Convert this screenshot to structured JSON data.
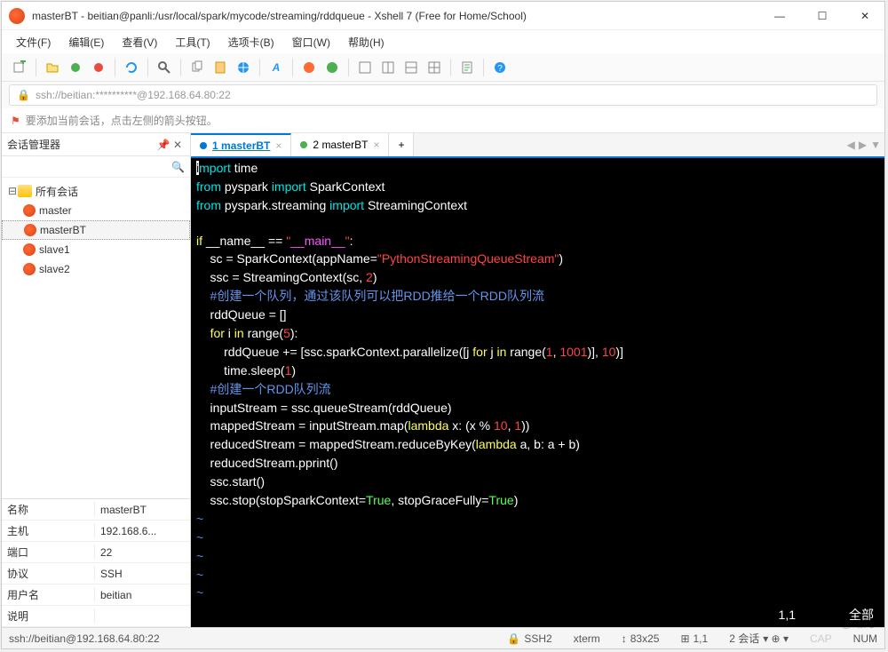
{
  "window": {
    "title": "masterBT - beitian@panli:/usr/local/spark/mycode/streaming/rddqueue - Xshell 7 (Free for Home/School)"
  },
  "menu": {
    "file": "文件(F)",
    "edit": "编辑(E)",
    "view": "查看(V)",
    "tools": "工具(T)",
    "tabs": "选项卡(B)",
    "window": "窗口(W)",
    "help": "帮助(H)"
  },
  "address": {
    "value": "ssh://beitian:**********@192.168.64.80:22"
  },
  "hint": {
    "text": "要添加当前会话，点击左侧的箭头按钮。"
  },
  "sidebar": {
    "title": "会话管理器",
    "root": "所有会话",
    "items": [
      {
        "label": "master"
      },
      {
        "label": "masterBT"
      },
      {
        "label": "slave1"
      },
      {
        "label": "slave2"
      }
    ]
  },
  "props": {
    "rows": [
      {
        "k": "名称",
        "v": "masterBT"
      },
      {
        "k": "主机",
        "v": "192.168.6..."
      },
      {
        "k": "端口",
        "v": "22"
      },
      {
        "k": "协议",
        "v": "SSH"
      },
      {
        "k": "用户名",
        "v": "beitian"
      },
      {
        "k": "说明",
        "v": ""
      }
    ]
  },
  "tabs": [
    {
      "num": "1",
      "label": "masterBT",
      "active": true,
      "color": "blue"
    },
    {
      "num": "2",
      "label": "masterBT",
      "active": false,
      "color": "green"
    }
  ],
  "code": {
    "l1a": "i",
    "l1b": "mport",
    "l1c": " time",
    "l2a": "from",
    "l2b": " pyspark ",
    "l2c": "import",
    "l2d": " SparkContext",
    "l3a": "from",
    "l3b": " pyspark.streaming ",
    "l3c": "import",
    "l3d": " StreamingContext",
    "l5a": "if",
    "l5b": " __name__ == ",
    "l5c": "\"",
    "l5d": "__main__",
    "l5e": "\"",
    "l5f": ":",
    "l6a": "    sc = SparkContext(appName=",
    "l6b": "\"PythonStreamingQueueStream\"",
    "l6c": ")",
    "l7a": "    ssc = StreamingContext(sc, ",
    "l7b": "2",
    "l7c": ")",
    "l8": "    #创建一个队列，通过该队列可以把RDD推给一个RDD队列流",
    "l9": "    rddQueue = []",
    "l10a": "    ",
    "l10b": "for",
    "l10c": " i ",
    "l10d": "in",
    "l10e": " range(",
    "l10f": "5",
    "l10g": "):",
    "l11a": "        rddQueue += [ssc.sparkContext.parallelize([j ",
    "l11b": "for",
    "l11c": " j ",
    "l11d": "in",
    "l11e": " range(",
    "l11f": "1",
    "l11g": ", ",
    "l11h": "1001",
    "l11i": ")], ",
    "l11j": "10",
    "l11k": ")]",
    "l12a": "        time.sleep(",
    "l12b": "1",
    "l12c": ")",
    "l13": "    #创建一个RDD队列流",
    "l14": "    inputStream = ssc.queueStream(rddQueue)",
    "l15a": "    mappedStream = inputStream.map(",
    "l15b": "lambda",
    "l15c": " x: (x % ",
    "l15d": "10",
    "l15e": ", ",
    "l15f": "1",
    "l15g": "))",
    "l16a": "    reducedStream = mappedStream.reduceByKey(",
    "l16b": "lambda",
    "l16c": " a, b: a + b)",
    "l17": "    reducedStream.pprint()",
    "l18": "    ssc.start()",
    "l19a": "    ssc.stop(stopSparkContext=",
    "l19b": "True",
    "l19c": ", stopGraceFully=",
    "l19d": "True",
    "l19e": ")",
    "tilde": "~"
  },
  "vimstatus": {
    "pos": "1,1",
    "mode": "全部"
  },
  "statusbar": {
    "conn": "ssh://beitian@192.168.64.80:22",
    "proto": "SSH2",
    "term": "xterm",
    "size": "83x25",
    "cursor": "1,1",
    "sessions": "2 会话",
    "caps": "CAP",
    "num": "NUM"
  },
  "watermark": "CSDN @绀月"
}
